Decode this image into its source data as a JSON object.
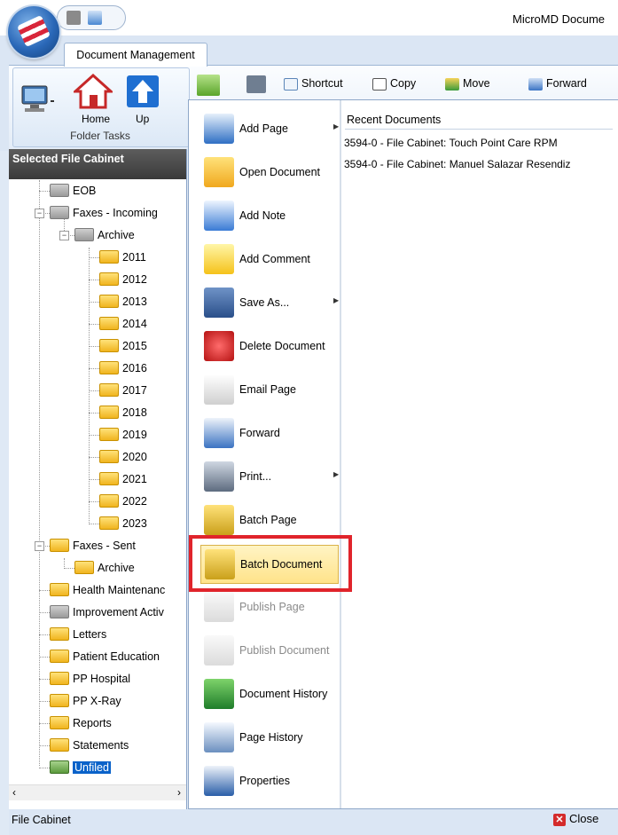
{
  "window": {
    "title": "MicroMD Docume"
  },
  "ribbon": {
    "tab_label": "Document Management",
    "group_label": "Folder Tasks",
    "home_label": "Home",
    "up_label": "Up"
  },
  "toolbar": {
    "shortcut": "Shortcut",
    "copy": "Copy",
    "move": "Move",
    "forward": "Forward"
  },
  "left_panel": {
    "header": "Selected File Cabinet",
    "footer": "File Cabinet",
    "tree": [
      {
        "label": "EOB",
        "icon": "gray"
      },
      {
        "label": "Faxes - Incoming",
        "icon": "gray"
      },
      {
        "label": "Archive",
        "icon": "gray"
      },
      {
        "label": "2011",
        "icon": "yellow"
      },
      {
        "label": "2012",
        "icon": "yellow"
      },
      {
        "label": "2013",
        "icon": "yellow"
      },
      {
        "label": "2014",
        "icon": "yellow"
      },
      {
        "label": "2015",
        "icon": "yellow"
      },
      {
        "label": "2016",
        "icon": "yellow"
      },
      {
        "label": "2017",
        "icon": "yellow"
      },
      {
        "label": "2018",
        "icon": "yellow"
      },
      {
        "label": "2019",
        "icon": "yellow"
      },
      {
        "label": "2020",
        "icon": "yellow"
      },
      {
        "label": "2021",
        "icon": "yellow"
      },
      {
        "label": "2022",
        "icon": "yellow"
      },
      {
        "label": "2023",
        "icon": "yellow"
      },
      {
        "label": "Faxes - Sent",
        "icon": "yellow"
      },
      {
        "label": "Archive",
        "icon": "yellow"
      },
      {
        "label": "Health Maintenanc",
        "icon": "yellow"
      },
      {
        "label": "Improvement Activ",
        "icon": "gray"
      },
      {
        "label": "Letters",
        "icon": "yellow"
      },
      {
        "label": "Patient Education",
        "icon": "yellow"
      },
      {
        "label": "PP Hospital",
        "icon": "yellow"
      },
      {
        "label": "PP X-Ray",
        "icon": "yellow"
      },
      {
        "label": "Reports",
        "icon": "yellow"
      },
      {
        "label": "Statements",
        "icon": "yellow"
      },
      {
        "label": "Unfiled",
        "icon": "green"
      }
    ]
  },
  "app_menu": {
    "items": [
      {
        "label": "Add Page",
        "icon": "add-page-icon",
        "submenu": true
      },
      {
        "label": "Open Document",
        "icon": "open-folder-icon"
      },
      {
        "label": "Add Note",
        "icon": "add-note-icon"
      },
      {
        "label": "Add Comment",
        "icon": "add-comment-icon"
      },
      {
        "label": "Save As...",
        "icon": "save-icon",
        "submenu": true
      },
      {
        "label": "Delete Document",
        "icon": "delete-icon"
      },
      {
        "label": "Email Page",
        "icon": "email-icon"
      },
      {
        "label": "Forward",
        "icon": "forward-icon"
      },
      {
        "label": "Print...",
        "icon": "print-icon",
        "submenu": true
      },
      {
        "label": "Batch Page",
        "icon": "batch-page-icon"
      },
      {
        "label": "Batch Document",
        "icon": "batch-document-icon"
      },
      {
        "label": "Publish Page",
        "icon": "publish-page-icon",
        "disabled": true
      },
      {
        "label": "Publish Document",
        "icon": "publish-document-icon",
        "disabled": true
      },
      {
        "label": "Document History",
        "icon": "document-history-icon"
      },
      {
        "label": "Page History",
        "icon": "page-history-icon"
      },
      {
        "label": "Properties",
        "icon": "properties-icon"
      }
    ],
    "recent_title": "Recent Documents",
    "recent": [
      "3594-0 - File Cabinet: Touch Point Care RPM",
      "3594-0 - File Cabinet: Manuel Salazar Resendiz"
    ],
    "close_label": "Close"
  },
  "colors": {
    "highlight_box": "#e0242b",
    "selection": "#0a62c9",
    "ribbon": "#dbe6f4"
  }
}
